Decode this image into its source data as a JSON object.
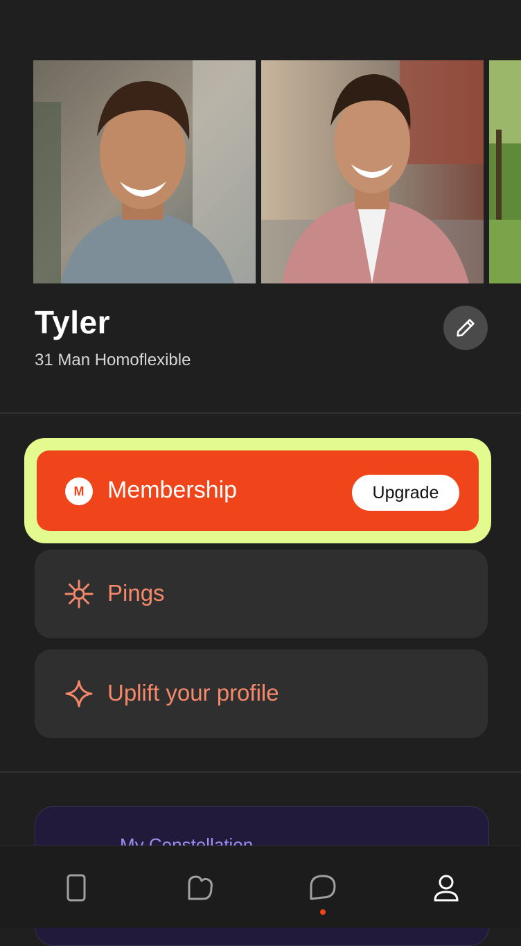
{
  "profile": {
    "name": "Tyler",
    "subtitle": "31 Man Homoflexible",
    "edit_icon": "pencil-icon"
  },
  "photos": [
    {
      "name": "profile-photo-1",
      "alt": "smiling man in grey shirt"
    },
    {
      "name": "profile-photo-2",
      "alt": "smiling man in pink shirt"
    },
    {
      "name": "profile-photo-3",
      "alt": "park scene"
    }
  ],
  "membership": {
    "badge": "M",
    "label": "Membership",
    "upgrade_label": "Upgrade"
  },
  "menu": {
    "pings": {
      "label": "Pings",
      "icon": "asterisk-icon"
    },
    "uplift": {
      "label": "Uplift your profile",
      "icon": "sparkle-icon"
    }
  },
  "constellation": {
    "label": "My Constellation"
  },
  "bottom_nav": [
    {
      "name": "nav-phone",
      "icon": "phone-icon"
    },
    {
      "name": "nav-likes",
      "icon": "heart-outline-icon"
    },
    {
      "name": "nav-chat",
      "icon": "chat-bubble-icon",
      "has_dot": true
    },
    {
      "name": "nav-profile",
      "icon": "person-icon",
      "active": true
    }
  ],
  "colors": {
    "background": "#1f1f1f",
    "accent_orange": "#f0441b",
    "highlight_green": "#e3fa8e",
    "card": "#2f2f2f",
    "salmon_text": "#f6896a",
    "purple_text": "#9d8ef0"
  }
}
